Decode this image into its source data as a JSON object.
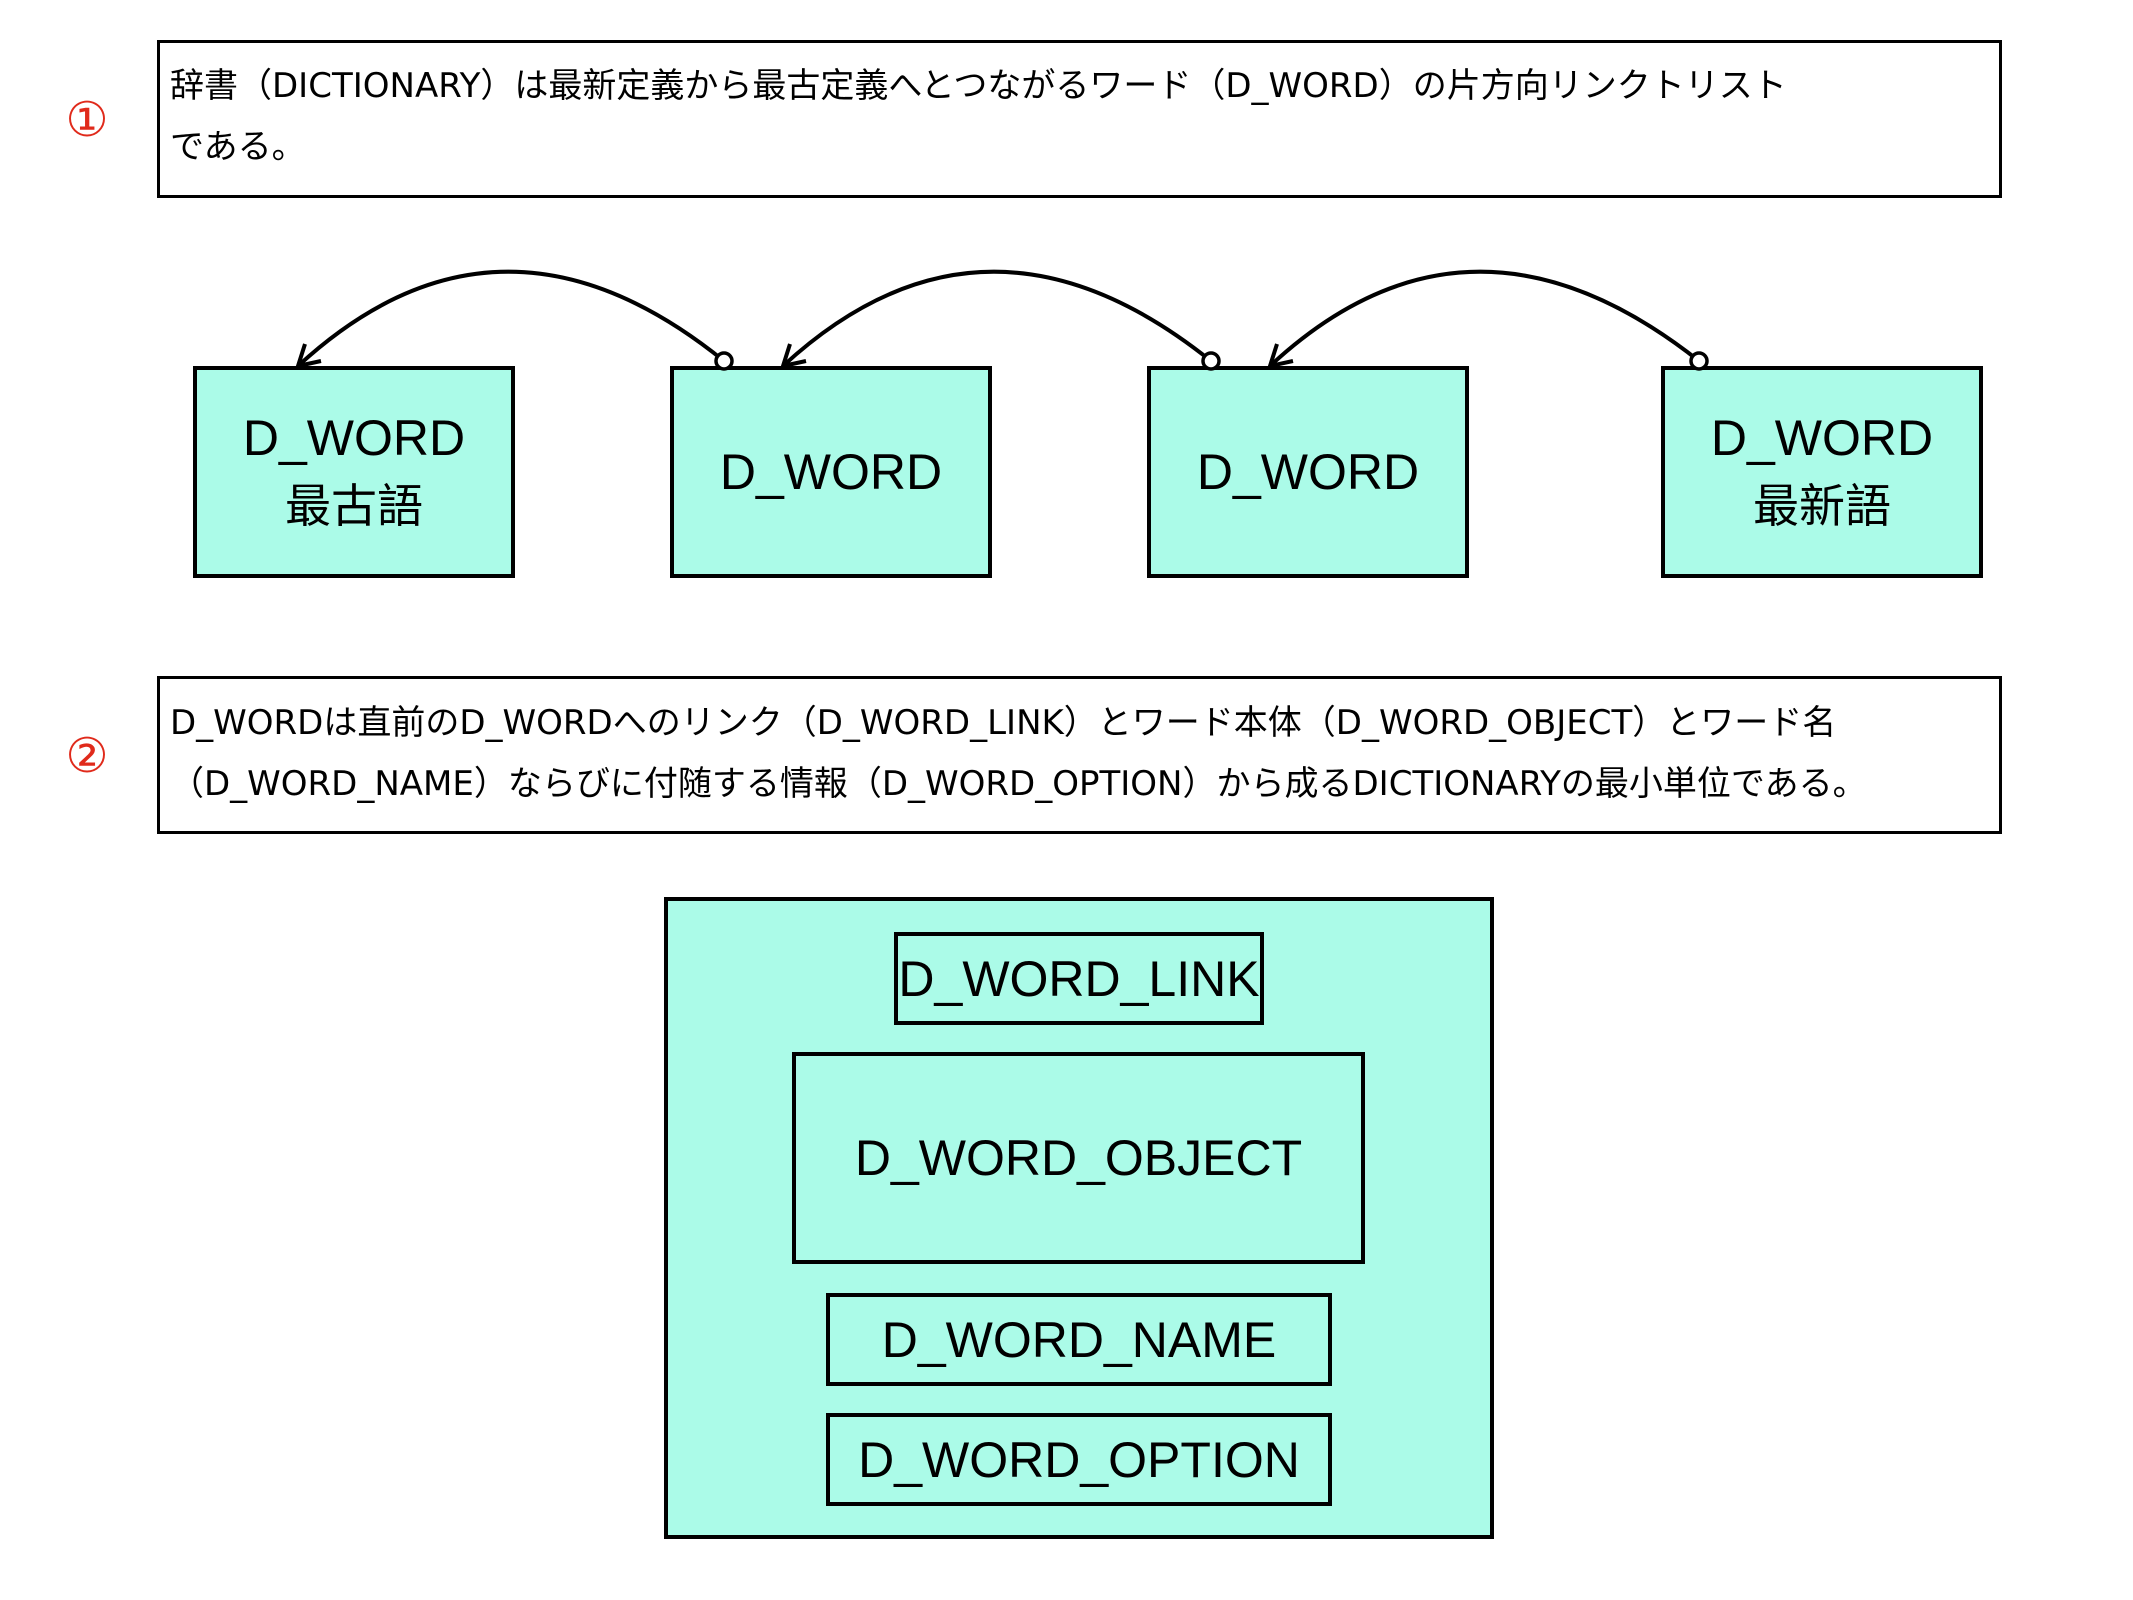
{
  "section1": {
    "number": "①",
    "lines": [
      "辞書（DICTIONARY）は最新定義から最古定義へとつながるワード（D_WORD）の片方向リンクトリスト",
      "である。"
    ]
  },
  "linked_list": {
    "nodes": [
      {
        "title": "D_WORD",
        "subtitle": "最古語"
      },
      {
        "title": "D_WORD",
        "subtitle": ""
      },
      {
        "title": "D_WORD",
        "subtitle": ""
      },
      {
        "title": "D_WORD",
        "subtitle": "最新語"
      }
    ]
  },
  "section2": {
    "number": "②",
    "lines": [
      "D_WORDは直前のD_WORDへのリンク（D_WORD_LINK）とワード本体（D_WORD_OBJECT）とワード名",
      "（D_WORD_NAME）ならびに付随する情報（D_WORD_OPTION）から成るDICTIONARYの最小単位である。"
    ]
  },
  "structure": {
    "components": [
      "D_WORD_LINK",
      "D_WORD_OBJECT",
      "D_WORD_NAME",
      "D_WORD_OPTION"
    ]
  },
  "colors": {
    "node_fill": "#abfbe8",
    "number_red": "#e02a1b",
    "stroke": "#000000"
  }
}
